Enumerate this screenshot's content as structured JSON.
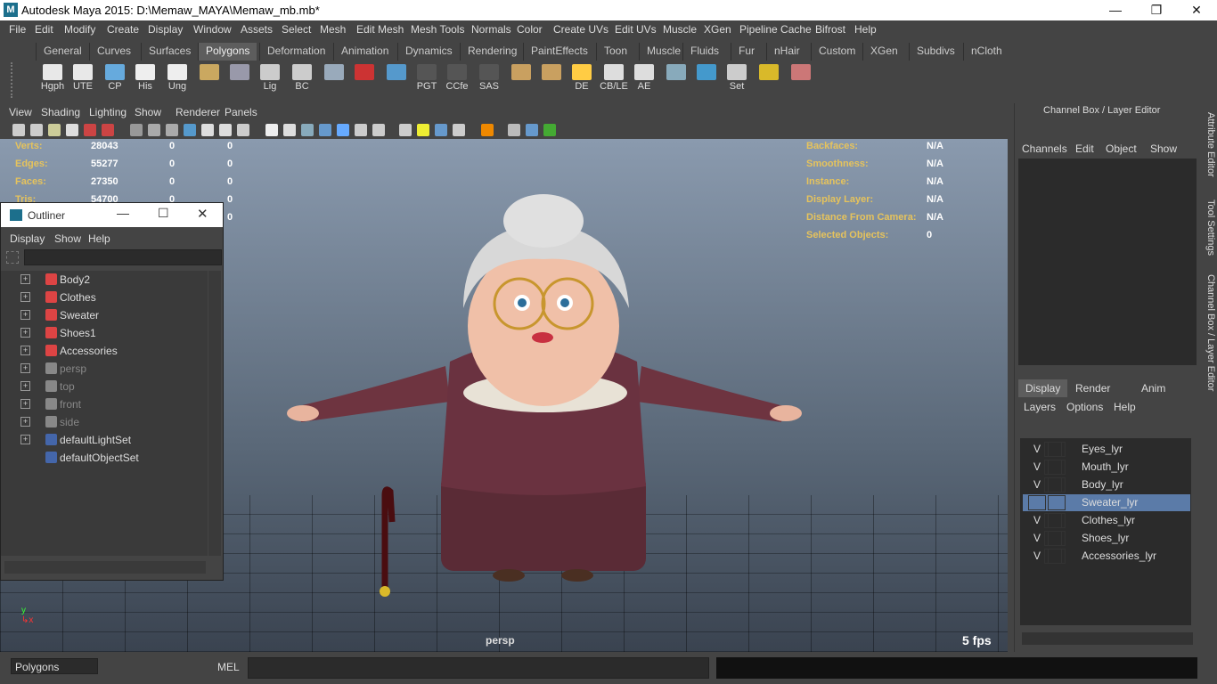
{
  "window": {
    "title": "Autodesk Maya 2015: D:\\Memaw_MAYA\\Memaw_mb.mb*",
    "logo": "M"
  },
  "menu": [
    "File",
    "Edit",
    "Modify",
    "Create",
    "Display",
    "Window",
    "Assets",
    "Select",
    "Mesh",
    "Edit Mesh",
    "Mesh Tools",
    "Normals",
    "Color",
    "Create UVs",
    "Edit UVs",
    "Muscle",
    "XGen",
    "Pipeline Cache",
    "Bifrost",
    "Help"
  ],
  "shelf_tabs": [
    "General",
    "Curves",
    "Surfaces",
    "Polygons",
    "Deformation",
    "Animation",
    "Dynamics",
    "Rendering",
    "PaintEffects",
    "Toon",
    "Muscle",
    "Fluids",
    "Fur",
    "nHair",
    "Custom",
    "XGen",
    "Subdivs",
    "nCloth"
  ],
  "active_shelf_tab": "Polygons",
  "shelf_buttons": [
    "Hgph",
    "UTE",
    "CP",
    "His",
    "Ung",
    "",
    "",
    "Lig",
    "BC",
    "",
    "",
    "",
    "PGT",
    "CCfe",
    "SAS",
    "",
    "",
    "DE",
    "CB/LE",
    "AE",
    "",
    "",
    "Set",
    "",
    ""
  ],
  "panel_menu": [
    "View",
    "Shading",
    "Lighting",
    "Show",
    "Renderer",
    "Panels"
  ],
  "hud_left": [
    {
      "label": "Verts:",
      "v": [
        "28043",
        "0",
        "0"
      ]
    },
    {
      "label": "Edges:",
      "v": [
        "55277",
        "0",
        "0"
      ]
    },
    {
      "label": "Faces:",
      "v": [
        "27350",
        "0",
        "0"
      ]
    },
    {
      "label": "Tris:",
      "v": [
        "54700",
        "0",
        "0"
      ]
    },
    {
      "label": "",
      "v": [
        "",
        "",
        "0"
      ]
    }
  ],
  "hud_right": [
    {
      "label": "Backfaces:",
      "v": "N/A"
    },
    {
      "label": "Smoothness:",
      "v": "N/A"
    },
    {
      "label": "Instance:",
      "v": "N/A"
    },
    {
      "label": "Display Layer:",
      "v": "N/A"
    },
    {
      "label": "Distance From Camera:",
      "v": "N/A"
    },
    {
      "label": "Selected Objects:",
      "v": "0"
    }
  ],
  "camera": "persp",
  "fps": "5 fps",
  "outliner": {
    "title": "Outliner",
    "menu": [
      "Display",
      "Show",
      "Help"
    ],
    "items": [
      {
        "name": "Body2",
        "kind": "mesh",
        "expand": true
      },
      {
        "name": "Clothes",
        "kind": "mesh",
        "expand": true
      },
      {
        "name": "Sweater",
        "kind": "mesh",
        "expand": true
      },
      {
        "name": "Shoes1",
        "kind": "mesh",
        "expand": true
      },
      {
        "name": "Accessories",
        "kind": "mesh",
        "expand": true
      },
      {
        "name": "persp",
        "kind": "camera",
        "expand": true
      },
      {
        "name": "top",
        "kind": "camera",
        "expand": true
      },
      {
        "name": "front",
        "kind": "camera",
        "expand": true
      },
      {
        "name": "side",
        "kind": "camera",
        "expand": true
      },
      {
        "name": "defaultLightSet",
        "kind": "set",
        "expand": true
      },
      {
        "name": "defaultObjectSet",
        "kind": "set",
        "expand": false
      }
    ]
  },
  "channel_box": {
    "title": "Channel Box / Layer Editor",
    "menu": [
      "Channels",
      "Edit",
      "Object",
      "Show"
    ]
  },
  "layer_editor": {
    "tabs": [
      "Display",
      "Render",
      "Anim"
    ],
    "active": "Display",
    "menu": [
      "Layers",
      "Options",
      "Help"
    ],
    "layers": [
      {
        "v": "V",
        "name": "Eyes_lyr"
      },
      {
        "v": "V",
        "name": "Mouth_lyr"
      },
      {
        "v": "V",
        "name": "Body_lyr"
      },
      {
        "v": "",
        "name": "Sweater_lyr",
        "selected": true
      },
      {
        "v": "V",
        "name": "Clothes_lyr"
      },
      {
        "v": "V",
        "name": "Shoes_lyr"
      },
      {
        "v": "V",
        "name": "Accessories_lyr"
      }
    ]
  },
  "side_tabs": [
    "Attribute Editor",
    "Tool Settings",
    "Channel Box / Layer Editor"
  ],
  "cmd": {
    "mode": "Polygons",
    "lang": "MEL"
  }
}
